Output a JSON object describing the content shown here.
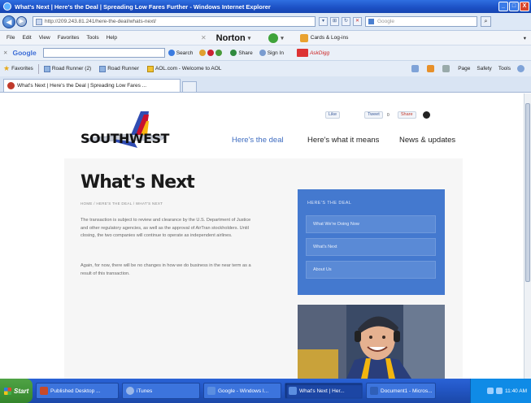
{
  "window": {
    "title": "What's Next | Here's the Deal | Spreading Low Fares Further - Windows Internet Explorer",
    "controls": [
      "_",
      "□",
      "X"
    ]
  },
  "address_bar": {
    "url": "http://209.243.81.241/here-the-deal/whats-next/",
    "search_placeholder": "Google"
  },
  "menu": {
    "items": [
      "File",
      "Edit",
      "View",
      "Favorites",
      "Tools",
      "Help"
    ],
    "norton_label": "Norton",
    "cards_label": "Cards & Log-ins"
  },
  "google_toolbar": {
    "label": "Google",
    "items": [
      "Search",
      "Share",
      "Sign In"
    ],
    "mail_label": "AskDigg"
  },
  "favorites_bar": {
    "label": "Favorites",
    "items": [
      "Road Runner (2)",
      "Road Runner",
      "AOL.com - Welcome to AOL"
    ],
    "commands": [
      "Page",
      "Safety",
      "Tools"
    ]
  },
  "tabs": [
    {
      "label": "What's Next | Here's the Deal | Spreading Low Fares ..."
    }
  ],
  "site": {
    "brand": "SOUTHWEST",
    "nav": [
      "Here's the deal",
      "Here's what it means",
      "News & updates"
    ],
    "social": {
      "like": "Like",
      "tweet": "Tweet",
      "tweet_count": "0",
      "share": "Share"
    }
  },
  "article": {
    "title": "What's Next",
    "breadcrumb": "HOME / HERE'S THE DEAL / WHAT'S NEXT",
    "paragraphs": [
      "The transaction is subject to review and clearance by the U.S. Department of Justice and other regulatory agencies, as well as the approval of AirTran stockholders. Until closing, the two companies will continue to operate as independent airlines.",
      "Again, for now, there will be no changes in how we do business in the near term as a result of this transaction."
    ]
  },
  "deal_panel": {
    "title": "HERE'S THE DEAL",
    "links": [
      "What We're Doing Now",
      "What's Next",
      "About Us"
    ]
  },
  "taskbar": {
    "start": "Start",
    "tasks": [
      "Published Desktop ...",
      "iTunes",
      "Google - Windows I...",
      "What's Next | Her...",
      "Document1 - Micros..."
    ],
    "clock": "11:40 AM"
  },
  "colors": {
    "title_bar": "#1c4fc4",
    "deal_panel": "#4479cf",
    "active_nav": "#3e6cc0",
    "southwest_blue": "#304cb2",
    "southwest_red": "#c8102e",
    "southwest_yellow": "#f9b612"
  }
}
